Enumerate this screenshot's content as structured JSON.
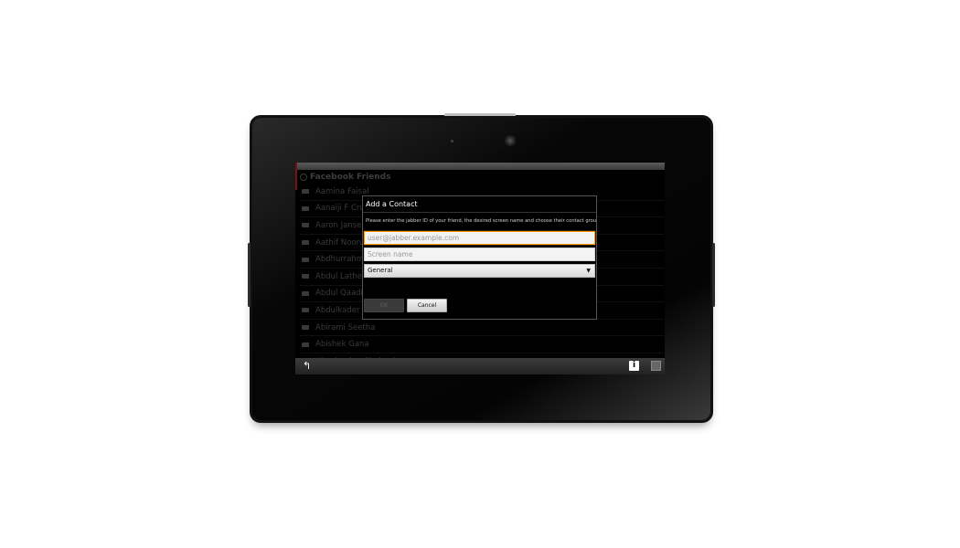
{
  "contacts": {
    "group_title": "Facebook Friends",
    "items": [
      "Aamina Faisal",
      "Aanaiji F Cruz",
      "Aaron Jansen",
      "Aathif Noorudeen",
      "Abdhurrahman",
      "Abdul Latheef",
      "Abdul Qaadir",
      "Abdulkader T",
      "Abirami Seetha",
      "Abishek Gana",
      "Aboobucker Shaheek"
    ]
  },
  "dialog": {
    "title": "Add a Contact",
    "message": "Please enter the jabber ID of your friend, the desired screen name and choose their contact group:",
    "jid_placeholder": "user@jabber.example.com",
    "screen_name_placeholder": "Screen name",
    "group_value": "General",
    "ok_label": "OK",
    "cancel_label": "Cancel"
  },
  "toolbar": {
    "info_label": "i"
  },
  "colors": {
    "focus_border": "#ff9900",
    "screen_bg": "#000000"
  }
}
